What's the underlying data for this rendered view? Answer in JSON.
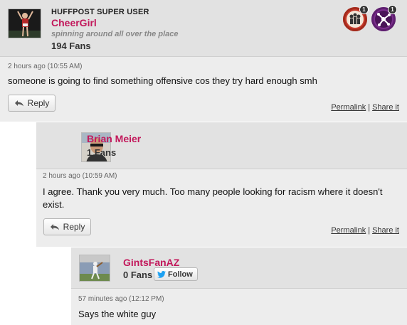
{
  "comments": [
    {
      "superuser_label": "HUFFPOST SUPER USER",
      "username": "CheerGirl",
      "tagline": "spinning around all over the place",
      "fans": "194 Fans",
      "timestamp": "2 hours ago (10:55 AM)",
      "text": "someone is going to find something offensive cos they try hard enough smh",
      "reply_label": "Reply",
      "permalink_label": "Permalink",
      "separator": "|",
      "share_label": "Share it",
      "badges": [
        {
          "icon": "community-badge-icon",
          "count": "1",
          "color": "#c63a2a"
        },
        {
          "icon": "networker-badge-icon",
          "count": "1",
          "color": "#7c2f8e"
        }
      ]
    },
    {
      "username": "Brian Meier",
      "fans": "1 Fans",
      "timestamp": "2 hours ago (10:59 AM)",
      "text": "I agree. Thank you very much. Too many people looking for racism where it doesn't exist.",
      "reply_label": "Reply",
      "permalink_label": "Permalink",
      "separator": "|",
      "share_label": "Share it"
    },
    {
      "username": "GintsFanAZ",
      "fans": "0 Fans",
      "follow_label": "Follow",
      "timestamp": "57 minutes ago (12:12 PM)",
      "text": "Says the white guy"
    }
  ],
  "colors": {
    "username": "#c2185b",
    "header_bg": "#e2e2e2",
    "body_bg": "#ededed",
    "twitter": "#1da1f2"
  }
}
